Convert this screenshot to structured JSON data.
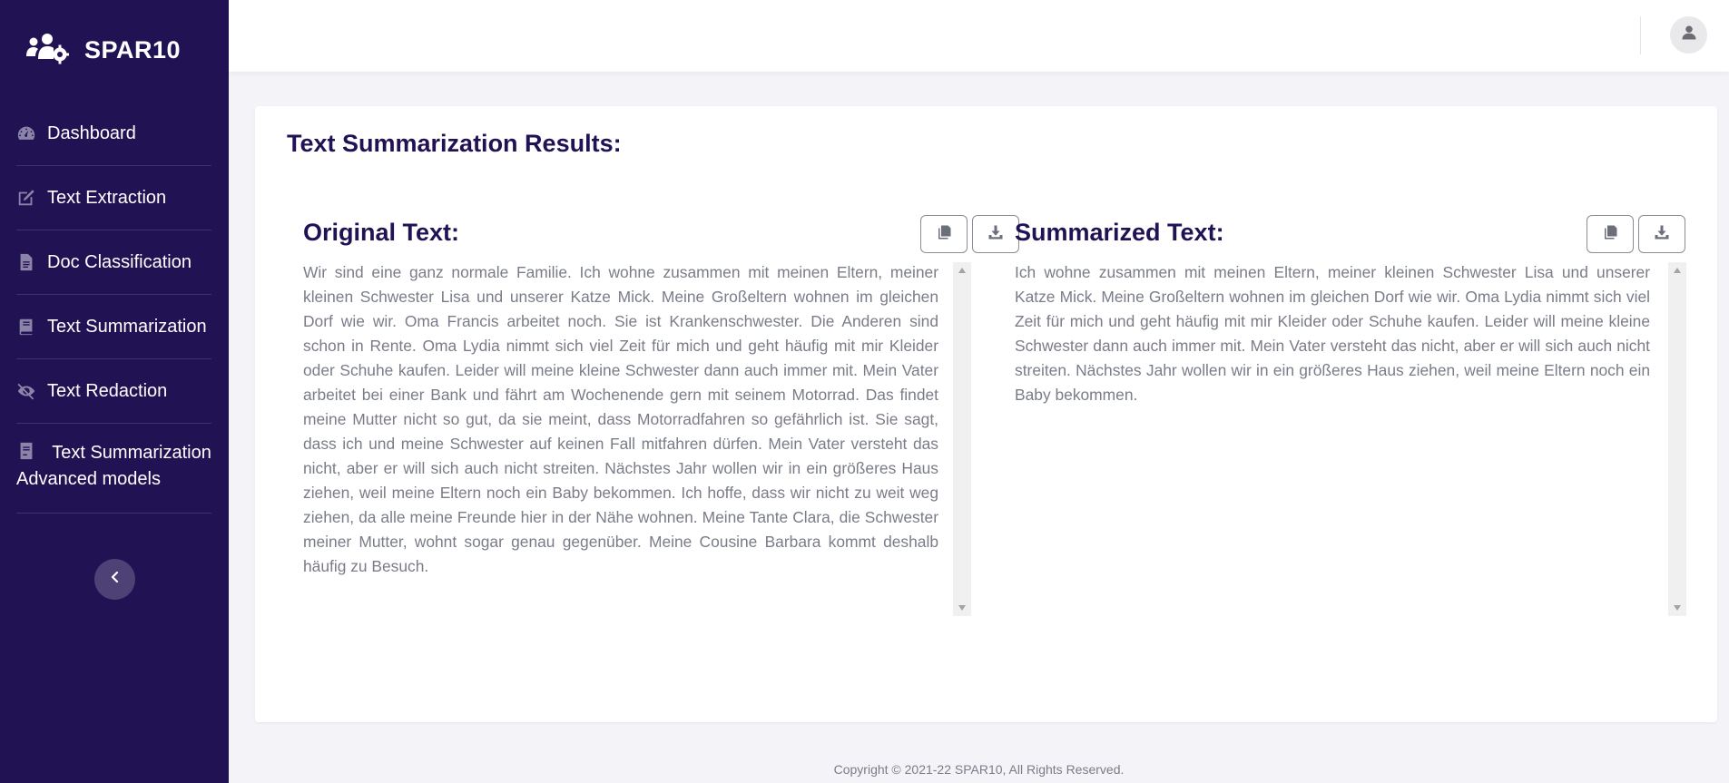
{
  "brand": {
    "name": "SPAR10",
    "logo_icon": "users-gear-icon"
  },
  "sidebar": {
    "items": [
      {
        "label": "Dashboard",
        "icon": "gauge-icon"
      },
      {
        "label": "Text Extraction",
        "icon": "edit-icon"
      },
      {
        "label": "Doc Classification",
        "icon": "document-icon"
      },
      {
        "label": "Text Summarization",
        "icon": "book-icon"
      },
      {
        "label": "Text Redaction",
        "icon": "eye-slash-icon"
      },
      {
        "label": "Text Summarization Advanced models",
        "icon": "file-icon"
      }
    ],
    "collapse_icon": "chevron-left-icon"
  },
  "topbar": {
    "user_icon": "user-icon"
  },
  "main": {
    "title": "Text Summarization Results:",
    "original": {
      "title": "Original Text:",
      "copy_icon": "copy-icon",
      "download_icon": "download-icon",
      "text": "Wir sind eine ganz normale Familie. Ich wohne zusammen mit meinen Eltern, meiner kleinen Schwester Lisa und unserer Katze Mick. Meine Großeltern wohnen im gleichen Dorf wie wir. Oma Francis arbeitet noch. Sie ist Krankenschwester. Die Anderen sind schon in Rente. Oma Lydia nimmt sich viel Zeit für mich und geht häufig mit mir Kleider oder Schuhe kaufen. Leider will meine kleine Schwester dann auch immer mit. Mein Vater arbeitet bei einer Bank und fährt am Wochenende gern mit seinem Motorrad. Das findet meine Mutter nicht so gut, da sie meint, dass Motorradfahren so gefährlich ist. Sie sagt, dass ich und meine Schwester auf keinen Fall mitfahren dürfen. Mein Vater versteht das nicht, aber er will sich auch nicht streiten. Nächstes Jahr wollen wir in ein größeres Haus ziehen, weil meine Eltern noch ein Baby bekommen. Ich hoffe, dass wir nicht zu weit weg ziehen, da alle meine Freunde hier in der Nähe wohnen. Meine Tante Clara, die Schwester meiner Mutter, wohnt sogar genau gegenüber. Meine Cousine Barbara kommt deshalb häufig zu Besuch."
    },
    "summary": {
      "title": "Summarized Text:",
      "copy_icon": "copy-icon",
      "download_icon": "download-icon",
      "text": "Ich wohne zusammen mit meinen Eltern, meiner kleinen Schwester Lisa und unserer Katze Mick. Meine Großeltern wohnen im gleichen Dorf wie wir. Oma Lydia nimmt sich viel Zeit für mich und geht häufig mit mir Kleider oder Schuhe kaufen. Leider will meine kleine Schwester dann auch immer mit. Mein Vater versteht das nicht, aber er will sich auch nicht streiten. Nächstes Jahr wollen wir in ein größeres Haus ziehen, weil meine Eltern noch ein Baby bekommen."
    }
  },
  "footer": {
    "copyright": "Copyright © 2021-22 SPAR10, All Rights Reserved."
  },
  "colors": {
    "sidebar_bg": "#211254",
    "heading": "#211254",
    "body_text": "#7a7d88"
  }
}
